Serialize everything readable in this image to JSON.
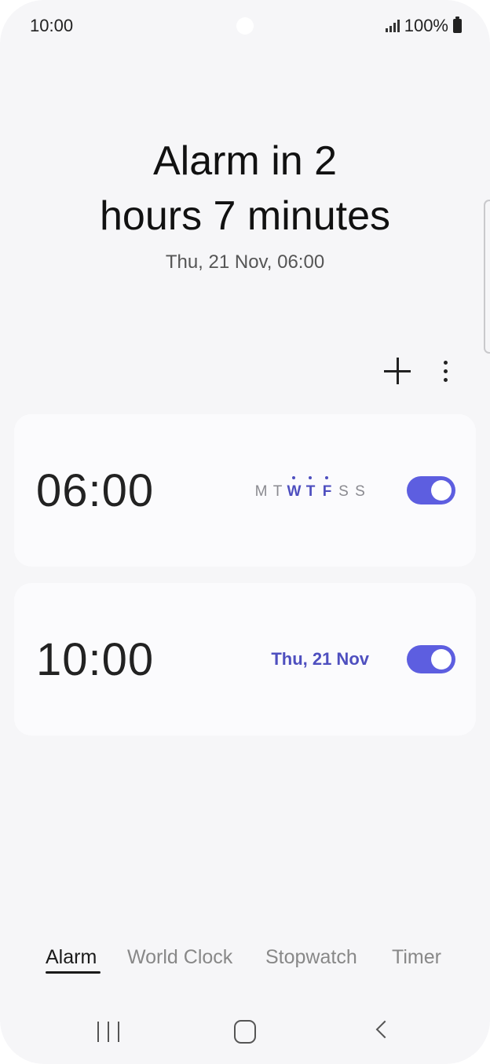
{
  "status_bar": {
    "time": "10:00",
    "battery_text": "100%",
    "icons": [
      "signal-icon",
      "battery-icon"
    ]
  },
  "header": {
    "title_line1": "Alarm in 2",
    "title_line2": "hours 7 minutes",
    "subtitle": "Thu, 21 Nov, 06:00"
  },
  "toolbar": {
    "add_icon": "plus-icon",
    "more_icon": "more-vertical-icon"
  },
  "alarms": [
    {
      "time": "06:00",
      "days": [
        {
          "label": "M",
          "active": false
        },
        {
          "label": "T",
          "active": false
        },
        {
          "label": "W",
          "active": true
        },
        {
          "label": "T",
          "active": true
        },
        {
          "label": "F",
          "active": true
        },
        {
          "label": "S",
          "active": false
        },
        {
          "label": "S",
          "active": false
        }
      ],
      "enabled": true
    },
    {
      "time": "10:00",
      "date": "Thu, 21 Nov",
      "enabled": true
    }
  ],
  "tabs": [
    {
      "label": "Alarm",
      "active": true
    },
    {
      "label": "World Clock",
      "active": false
    },
    {
      "label": "Stopwatch",
      "active": false
    },
    {
      "label": "Timer",
      "active": false
    }
  ],
  "colors": {
    "accent": "#5d5ee0",
    "accent_text": "#4e4fbf",
    "background": "#f6f6f8",
    "card": "#fbfbfd"
  },
  "nav": {
    "icons": [
      "recent-apps-icon",
      "home-icon",
      "back-icon"
    ]
  }
}
